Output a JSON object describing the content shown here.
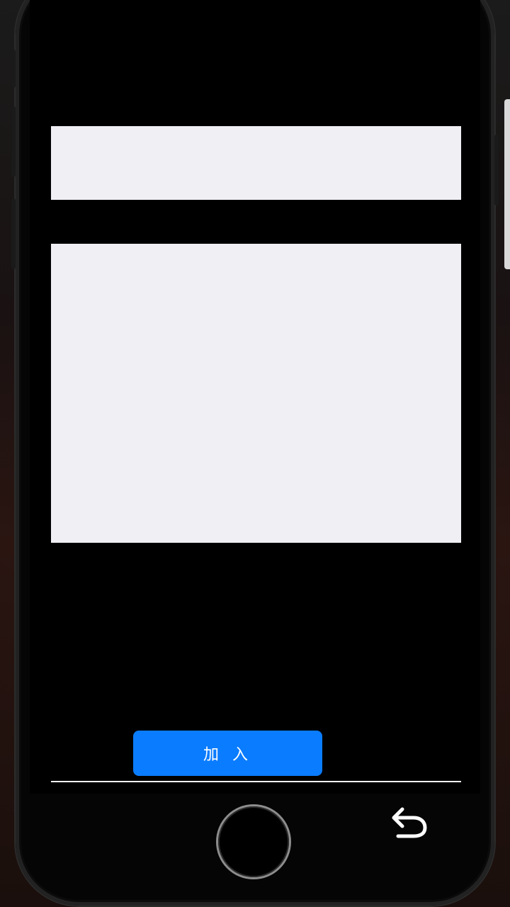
{
  "join_button": {
    "label": "加 入"
  },
  "icons": {
    "back": "undo-arrow-icon",
    "home": "home-button"
  },
  "colors": {
    "accent": "#0a7cff",
    "panel": "#efeff4",
    "screen": "#000000"
  }
}
